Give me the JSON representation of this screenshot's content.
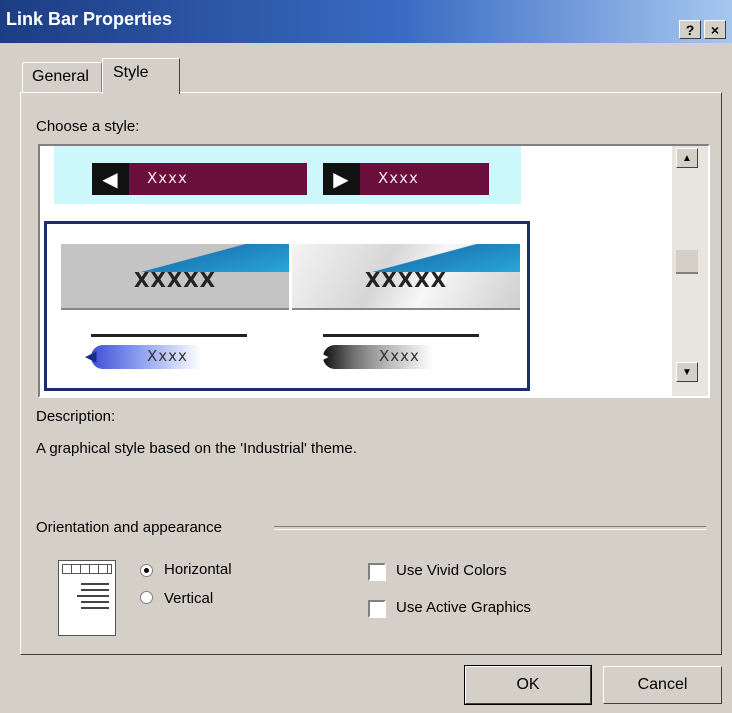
{
  "window": {
    "title": "Link Bar Properties",
    "help_button": "?",
    "close_button": "×"
  },
  "tabs": {
    "general": "General",
    "style": "Style"
  },
  "style_section": {
    "label": "Choose a style:",
    "samples": {
      "row1_left": "Xxxx",
      "row1_right": "Xxxx",
      "industrial_left": "XXXXX",
      "industrial_right": "XXXXX",
      "line_left": "Xxxx",
      "line_right": "Xxxx"
    }
  },
  "description": {
    "label": "Description:",
    "text": "A graphical style based on the 'Industrial' theme."
  },
  "orientation": {
    "group_label": "Orientation and appearance",
    "horizontal": "Horizontal",
    "vertical": "Vertical",
    "selected": "Horizontal",
    "use_vivid_colors": "Use Vivid Colors",
    "use_active_graphics": "Use Active Graphics",
    "vivid_checked": false,
    "active_checked": false
  },
  "buttons": {
    "ok": "OK",
    "cancel": "Cancel"
  }
}
